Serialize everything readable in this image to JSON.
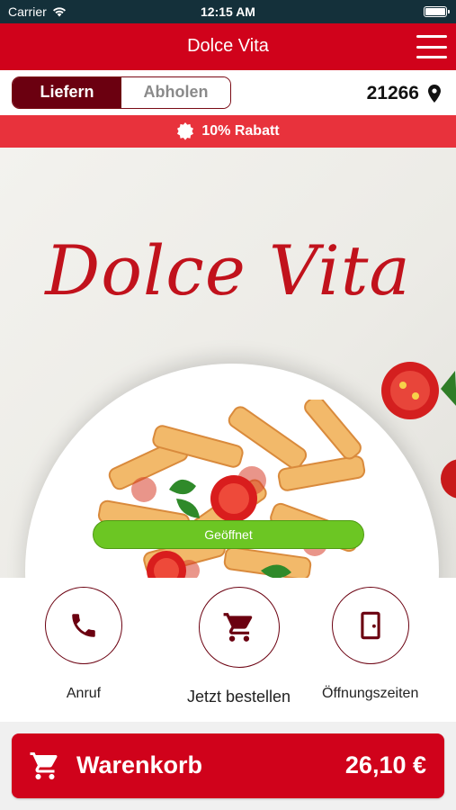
{
  "status_bar": {
    "carrier": "Carrier",
    "time": "12:15 AM",
    "battery_level": 1.0
  },
  "header": {
    "title": "Dolce Vita",
    "menu_icon": "hamburger-menu-icon"
  },
  "mode_toggle": {
    "options": [
      {
        "label": "Liefern",
        "active": true
      },
      {
        "label": "Abholen",
        "active": false
      }
    ]
  },
  "location": {
    "zip": "21266",
    "icon": "location-pin-icon"
  },
  "promo": {
    "icon": "badge-icon",
    "text": "10% Rabatt"
  },
  "hero": {
    "logo_text": "Dolce Vita",
    "status": "Geöffnet"
  },
  "actions": [
    {
      "label": "Anruf",
      "icon": "phone-icon"
    },
    {
      "label": "Jetzt bestellen",
      "icon": "cart-icon"
    },
    {
      "label": "Öffnungszeiten",
      "icon": "door-icon"
    }
  ],
  "cart": {
    "label": "Warenkorb",
    "total": "26,10 €",
    "icon": "cart-icon"
  },
  "colors": {
    "brand_red": "#d0021b",
    "dark_red": "#6b0010",
    "promo_red": "#e8323c",
    "open_green": "#6cc623",
    "status_bar": "#14303a"
  }
}
